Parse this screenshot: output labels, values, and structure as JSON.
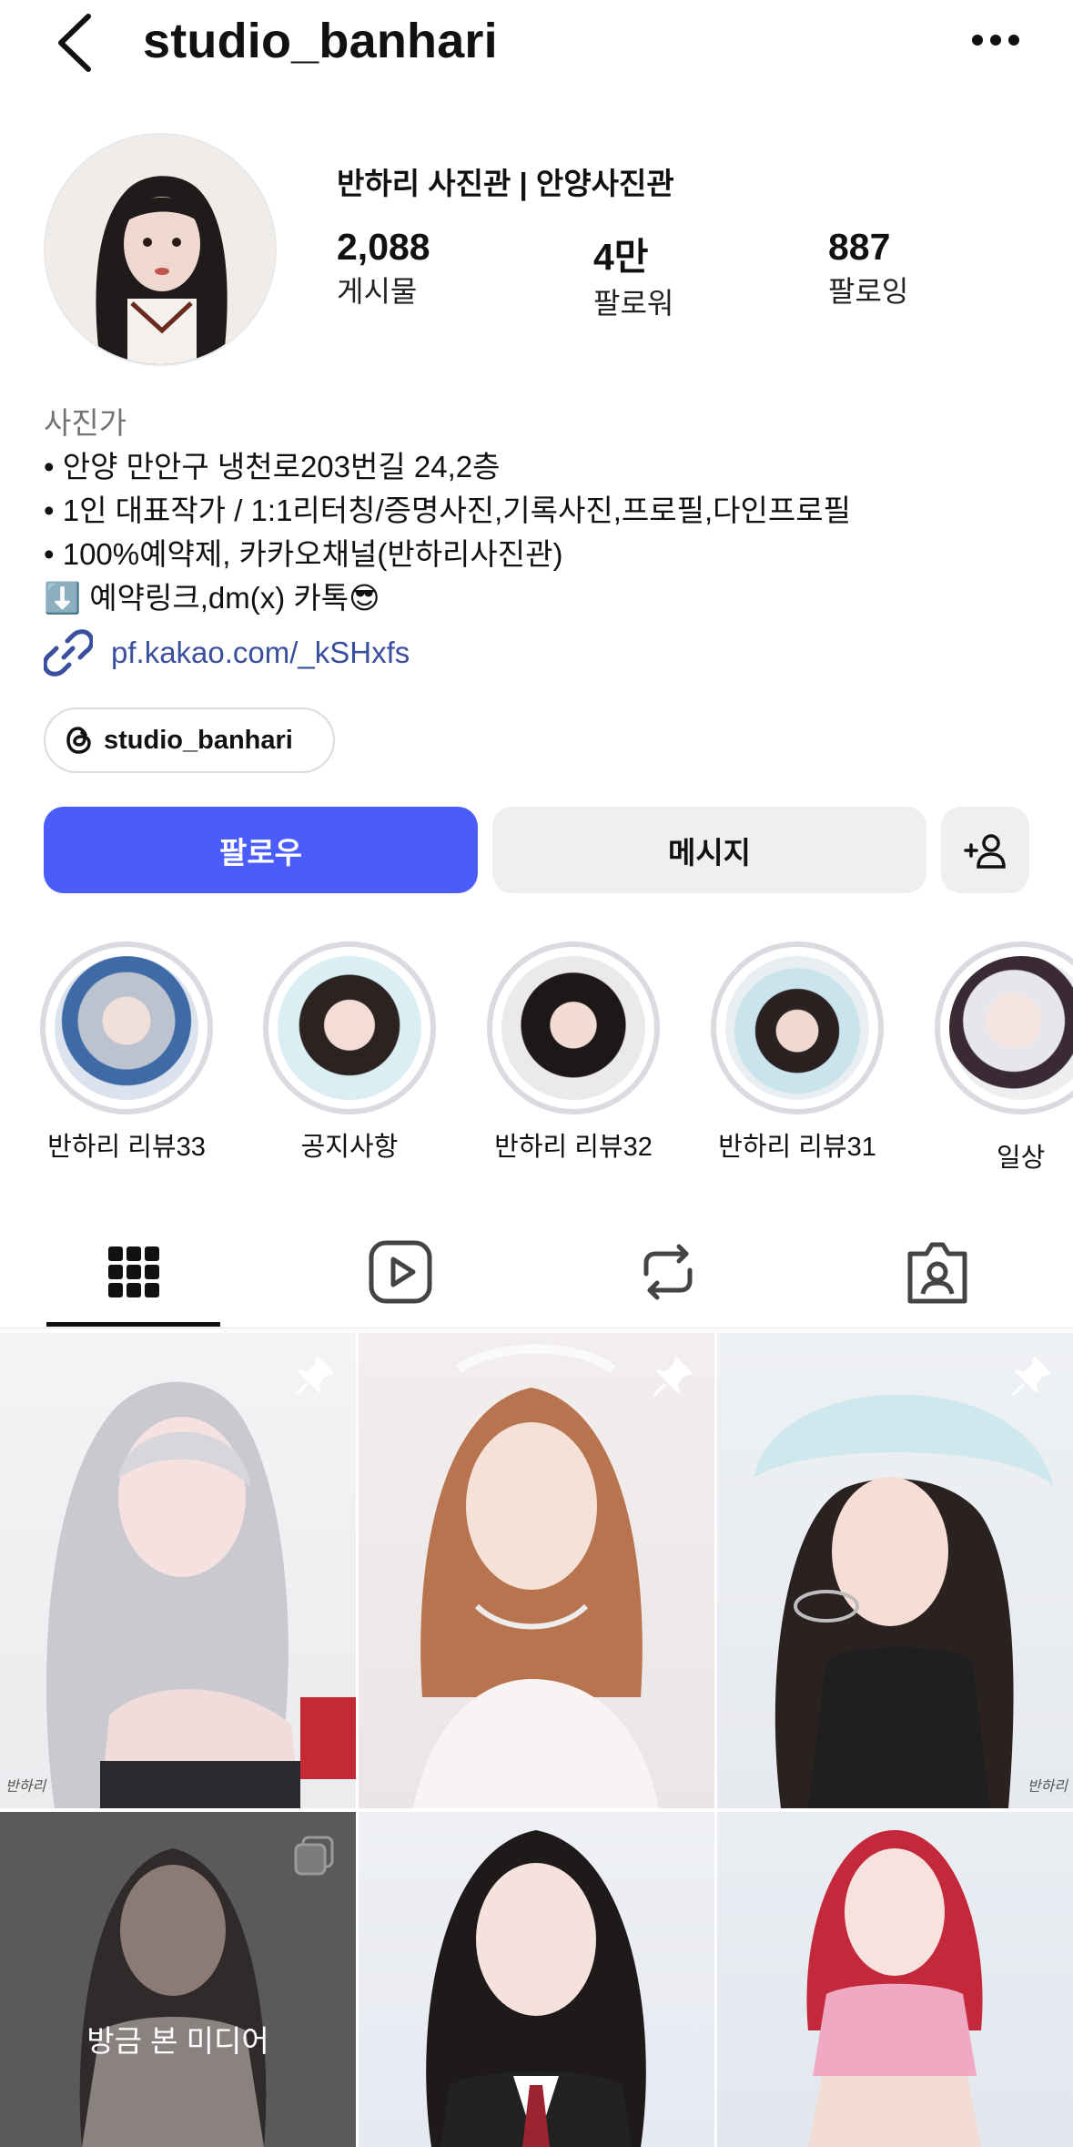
{
  "header": {
    "username": "studio_banhari",
    "back_icon": "chevron-left-icon",
    "more_icon": "more-horizontal-icon"
  },
  "profile": {
    "display_name": "반하리 사진관 | 안양사진관",
    "stats": [
      {
        "value": "2,088",
        "label": "게시물"
      },
      {
        "value": "4만",
        "label": "팔로워"
      },
      {
        "value": "887",
        "label": "팔로잉"
      }
    ],
    "category": "사진가",
    "bio": [
      "• 안양 만안구 냉천로203번길 24,2층",
      "• 1인 대표작가 / 1:1리터칭/증명사진,기록사진,프로필,다인프로필",
      "• 100%예약제, 카카오채널(반하리사진관)",
      "⬇️ 예약링크,dm(x) 카톡😎"
    ],
    "link": "pf.kakao.com/_kSHxfs",
    "threads_handle": "studio_banhari"
  },
  "actions": {
    "follow_label": "팔로우",
    "message_label": "메시지"
  },
  "highlights": [
    {
      "label": "반하리 리뷰33"
    },
    {
      "label": "공지사항"
    },
    {
      "label": "반하리 리뷰32"
    },
    {
      "label": "반하리 리뷰31"
    },
    {
      "label": "일상"
    }
  ],
  "tabs": [
    {
      "name": "grid",
      "icon": "grid-icon",
      "active": true
    },
    {
      "name": "reels",
      "icon": "reels-icon",
      "active": false
    },
    {
      "name": "reposts",
      "icon": "repost-icon",
      "active": false
    },
    {
      "name": "tagged",
      "icon": "tagged-icon",
      "active": false
    }
  ],
  "grid": {
    "recent_media_label": "방금 본 미디어",
    "signature": "반하리"
  },
  "colors": {
    "accent": "#4a5df9",
    "link": "#3b4f9f",
    "secondary_button": "#efeff1"
  }
}
